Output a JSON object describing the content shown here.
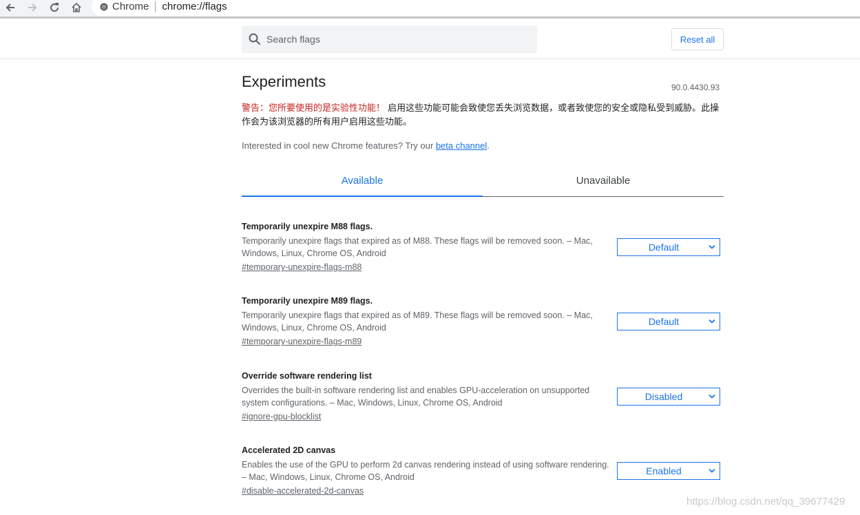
{
  "browser": {
    "site_label": "Chrome",
    "url": "chrome://flags"
  },
  "header": {
    "search_placeholder": "Search flags",
    "reset_label": "Reset all"
  },
  "page": {
    "title": "Experiments",
    "version": "90.0.4430.93",
    "warning_red": "警告：您所要使用的是实验性功能！",
    "warning_rest": " 启用这些功能可能会致使您丢失浏览数据，或者致使您的安全或隐私受到威胁。此操作会为该浏览器的所有用户启用这些功能。",
    "promo_text": "Interested in cool new Chrome features? Try our ",
    "promo_link": "beta channel",
    "promo_end": "."
  },
  "tabs": [
    {
      "label": "Available"
    },
    {
      "label": "Unavailable"
    }
  ],
  "experiments": [
    {
      "name": "Temporarily unexpire M88 flags.",
      "description": "Temporarily unexpire flags that expired as of M88. These flags will be removed soon. – Mac, Windows, Linux, Chrome OS, Android",
      "link": "#temporary-unexpire-flags-m88",
      "value": "Default"
    },
    {
      "name": "Temporarily unexpire M89 flags.",
      "description": "Temporarily unexpire flags that expired as of M89. These flags will be removed soon. – Mac, Windows, Linux, Chrome OS, Android",
      "link": "#temporary-unexpire-flags-m89",
      "value": "Default"
    },
    {
      "name": "Override software rendering list",
      "description": "Overrides the built-in software rendering list and enables GPU-acceleration on unsupported system configurations. – Mac, Windows, Linux, Chrome OS, Android",
      "link": "#ignore-gpu-blocklist",
      "value": "Disabled"
    },
    {
      "name": "Accelerated 2D canvas",
      "description": "Enables the use of the GPU to perform 2d canvas rendering instead of using software rendering. – Mac, Windows, Linux, Chrome OS, Android",
      "link": "#disable-accelerated-2d-canvas",
      "value": "Enabled"
    }
  ],
  "watermark": "https://blog.csdn.net/qq_39677429",
  "colors": {
    "accent": "#1a73e8",
    "warning": "#c5221f"
  },
  "icons": [
    "back-arrow-icon",
    "forward-arrow-icon",
    "reload-icon",
    "home-icon",
    "chrome-logo-icon",
    "search-icon",
    "chevron-down-icon"
  ]
}
